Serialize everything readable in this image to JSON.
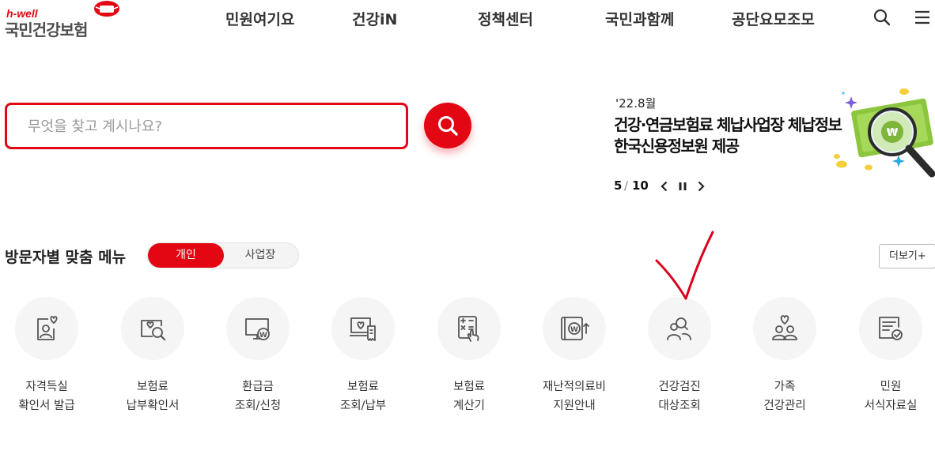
{
  "header": {
    "logo_tag": "h-well",
    "logo_name": "국민건강보험",
    "nav": [
      "민원여기요",
      "건강iN",
      "정책센터",
      "국민과함께",
      "공단요모조모"
    ],
    "search_icon": "search-icon",
    "menu_icon": "hamburger-menu-icon"
  },
  "search": {
    "placeholder": "무엇을 찾고 계시나요?",
    "value": "",
    "button_icon": "search-icon"
  },
  "notice": {
    "date": "'22.8월",
    "title_line1": "건강·연금보험료 체납사업장 체납정보",
    "title_line2": "한국신용정보원 제공",
    "page_current": "5",
    "page_separator": "/",
    "page_total": "10",
    "prev_icon": "chevron-left-icon",
    "pause_icon": "pause-icon",
    "next_icon": "chevron-right-icon",
    "illustration": "money-magnifier-illustration"
  },
  "visitor_menu": {
    "title": "방문자별 맞춤 메뉴",
    "tabs": [
      "개인",
      "사업장"
    ],
    "active_tab": "개인",
    "more_label": "더보기+"
  },
  "quick_menu": [
    {
      "line1": "자격득실",
      "line2": "확인서 발급",
      "icon": "person-card-heart-icon"
    },
    {
      "line1": "보험료",
      "line2": "납부확인서",
      "icon": "document-magnifier-icon"
    },
    {
      "line1": "환급금",
      "line2": "조회/신청",
      "icon": "monitor-won-icon"
    },
    {
      "line1": "보험료",
      "line2": "조회/납부",
      "icon": "laptop-receipt-icon"
    },
    {
      "line1": "보험료",
      "line2": "계산기",
      "icon": "calculator-hand-icon"
    },
    {
      "line1": "재난적의료비",
      "line2": "지원안내",
      "icon": "book-won-arrow-icon"
    },
    {
      "line1": "건강검진",
      "line2": "대상조회",
      "icon": "people-search-icon"
    },
    {
      "line1": "가족",
      "line2": "건강관리",
      "icon": "family-heart-icon"
    },
    {
      "line1": "민원",
      "line2": "서식자료실",
      "icon": "form-check-icon"
    }
  ],
  "colors": {
    "brand_red": "#e30613",
    "annotation_red": "#d9001b",
    "text_dark": "#222222",
    "icon_gray": "#555555",
    "circle_bg": "#f5f5f5"
  }
}
